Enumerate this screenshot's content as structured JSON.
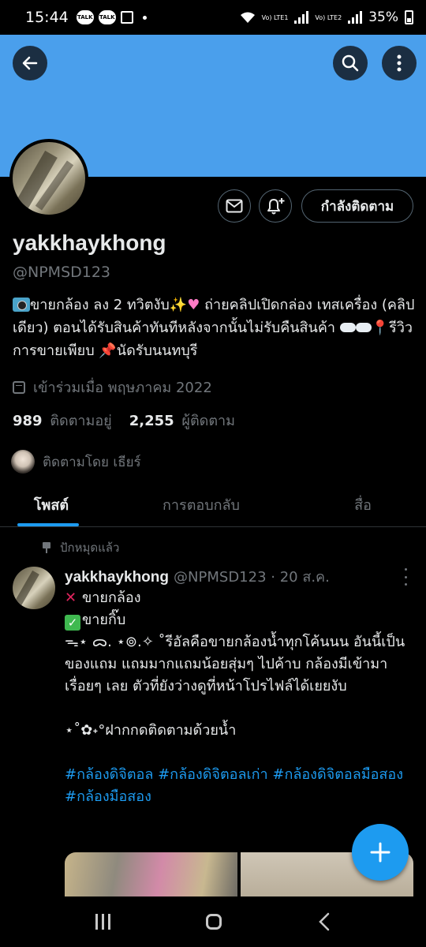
{
  "status_bar": {
    "time": "15:44",
    "talk_label": "TALK",
    "lte1": "Vo) LTE1",
    "lte2": "Vo) LTE2",
    "battery": "35%"
  },
  "profile": {
    "name": "yakkhaykhong",
    "handle": "@NPMSD123",
    "following_button": "กำลังติดตาม",
    "bio_part1": "ขายกล้อง ลง 2 ทวิตงับ",
    "bio_part2": " ถ่ายคลิปเปิดกล่อง เทสเครื่อง (คลิปเดียว) ตอนได้รับสินค้าทันทีหลังจากนั้นไม่รับคืนสินค้า ",
    "bio_part3": "รีวิวการขายเพียบ ",
    "bio_part4": "นัดรับนนทบุรี",
    "joined": "เข้าร่วมเมื่อ พฤษภาคม 2022",
    "following_count": "989",
    "following_label": "ติดตามอยู่",
    "followers_count": "2,255",
    "followers_label": "ผู้ติดตาม",
    "followed_by": "ติดตามโดย เธียร์"
  },
  "tabs": [
    {
      "label": "โพสต์",
      "active": true
    },
    {
      "label": "การตอบกลับ",
      "active": false
    },
    {
      "label": "สื่อ",
      "active": false
    }
  ],
  "pinned_tweet": {
    "pinned_label": "ปักหมุดแล้ว",
    "name": "yakkhaykhong",
    "meta": "@NPMSD123 · 20 ส.ค.",
    "line1": "ขายกล้อง",
    "line2": "ขายกิ๊บ",
    "line3": "ᯓ⋆ ᯅ. ⋆⊚.✧ ˚รีอัลคือขายกล้องน้ำทุกโค้นนน อันนี้เป็นของแถม แถมมากแถมน้อยสุ่มๆ ไปค้าบ กล้องมีเข้ามาเรื่อยๆ เลย ตัวที่ยังว่างดูที่หน้าโปรไฟล์ได้เยยงับ",
    "line4": "⋆˚✿˖°ฝากกดติดตามด้วยน้ำ",
    "hashtags_line1": "#กล้องดิจิตอล #กล้องดิจิตอลเก่า #กล้องดิจิตอลมือสอง",
    "hashtags_line2": "#กล้องมือสอง"
  },
  "colors": {
    "banner": "#4a9fec",
    "accent": "#1d9bf0",
    "background": "#000000",
    "secondary_text": "#71767b"
  }
}
